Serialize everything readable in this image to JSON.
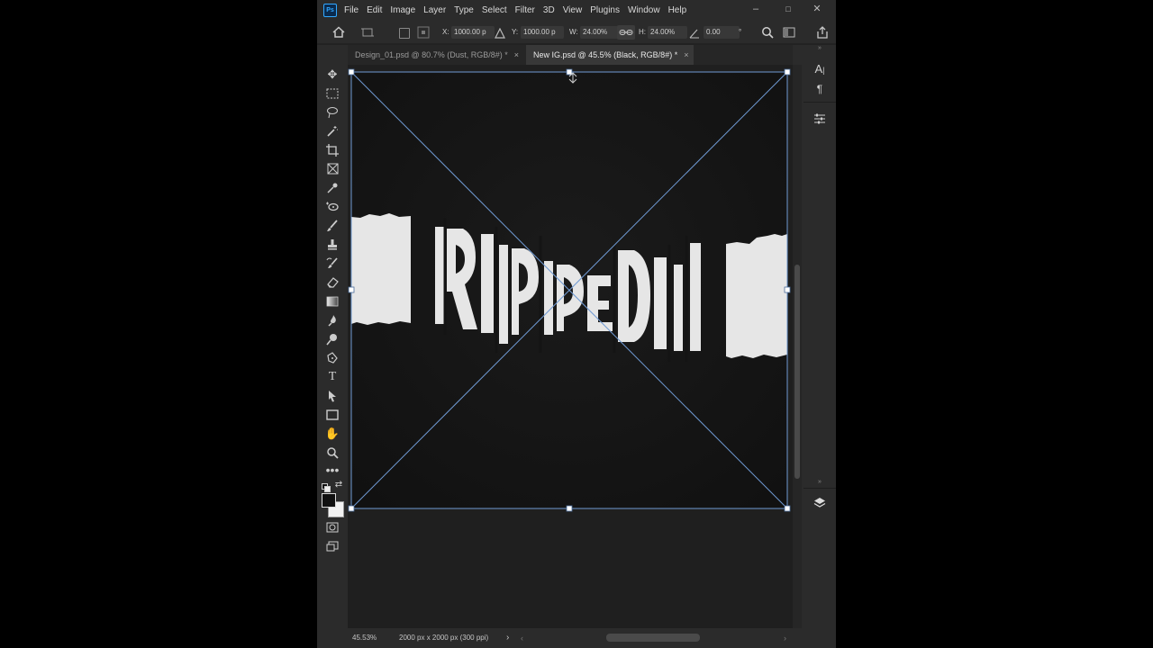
{
  "app": {
    "logo": "Ps"
  },
  "menu": [
    "File",
    "Edit",
    "Image",
    "Layer",
    "Type",
    "Select",
    "Filter",
    "3D",
    "View",
    "Plugins",
    "Window",
    "Help"
  ],
  "window_controls": {
    "minimize": "–",
    "maximize": "□",
    "close": "✕"
  },
  "options": {
    "x_label": "X:",
    "x_value": "1000.00 p",
    "y_label": "Y:",
    "y_value": "1000.00 p",
    "w_label": "W:",
    "w_value": "24.00%",
    "h_label": "H:",
    "h_value": "24.00%",
    "angle_value": "0.00",
    "angle_unit": "°"
  },
  "tabs": [
    {
      "label": "Design_01.psd @ 80.7% (Dust, RGB/8#) *",
      "close": "×",
      "active": false
    },
    {
      "label": "New IG.psd @ 45.5% (Black, RGB/8#) *",
      "close": "×",
      "active": true
    }
  ],
  "artwork": {
    "text": "RIPPED",
    "background": "#1a1a1a",
    "paper": "#e6e6e6"
  },
  "transform": {
    "color": "#6f9ad3"
  },
  "status": {
    "zoom": "45.53%",
    "doc_info": "2000 px x 2000 px (300 ppi)",
    "arrow": "›"
  },
  "icons": {
    "tools": [
      "move-icon",
      "marquee-icon",
      "lasso-icon",
      "magic-wand-icon",
      "crop-icon",
      "frame-icon",
      "eyedropper-icon",
      "healing-icon",
      "brush-icon",
      "stamp-icon",
      "history-brush-icon",
      "eraser-icon",
      "gradient-icon",
      "blur-icon",
      "dodge-icon",
      "pen-icon",
      "type-icon",
      "path-select-icon",
      "rectangle-icon",
      "hand-icon",
      "zoom-icon",
      "more-icon"
    ]
  }
}
